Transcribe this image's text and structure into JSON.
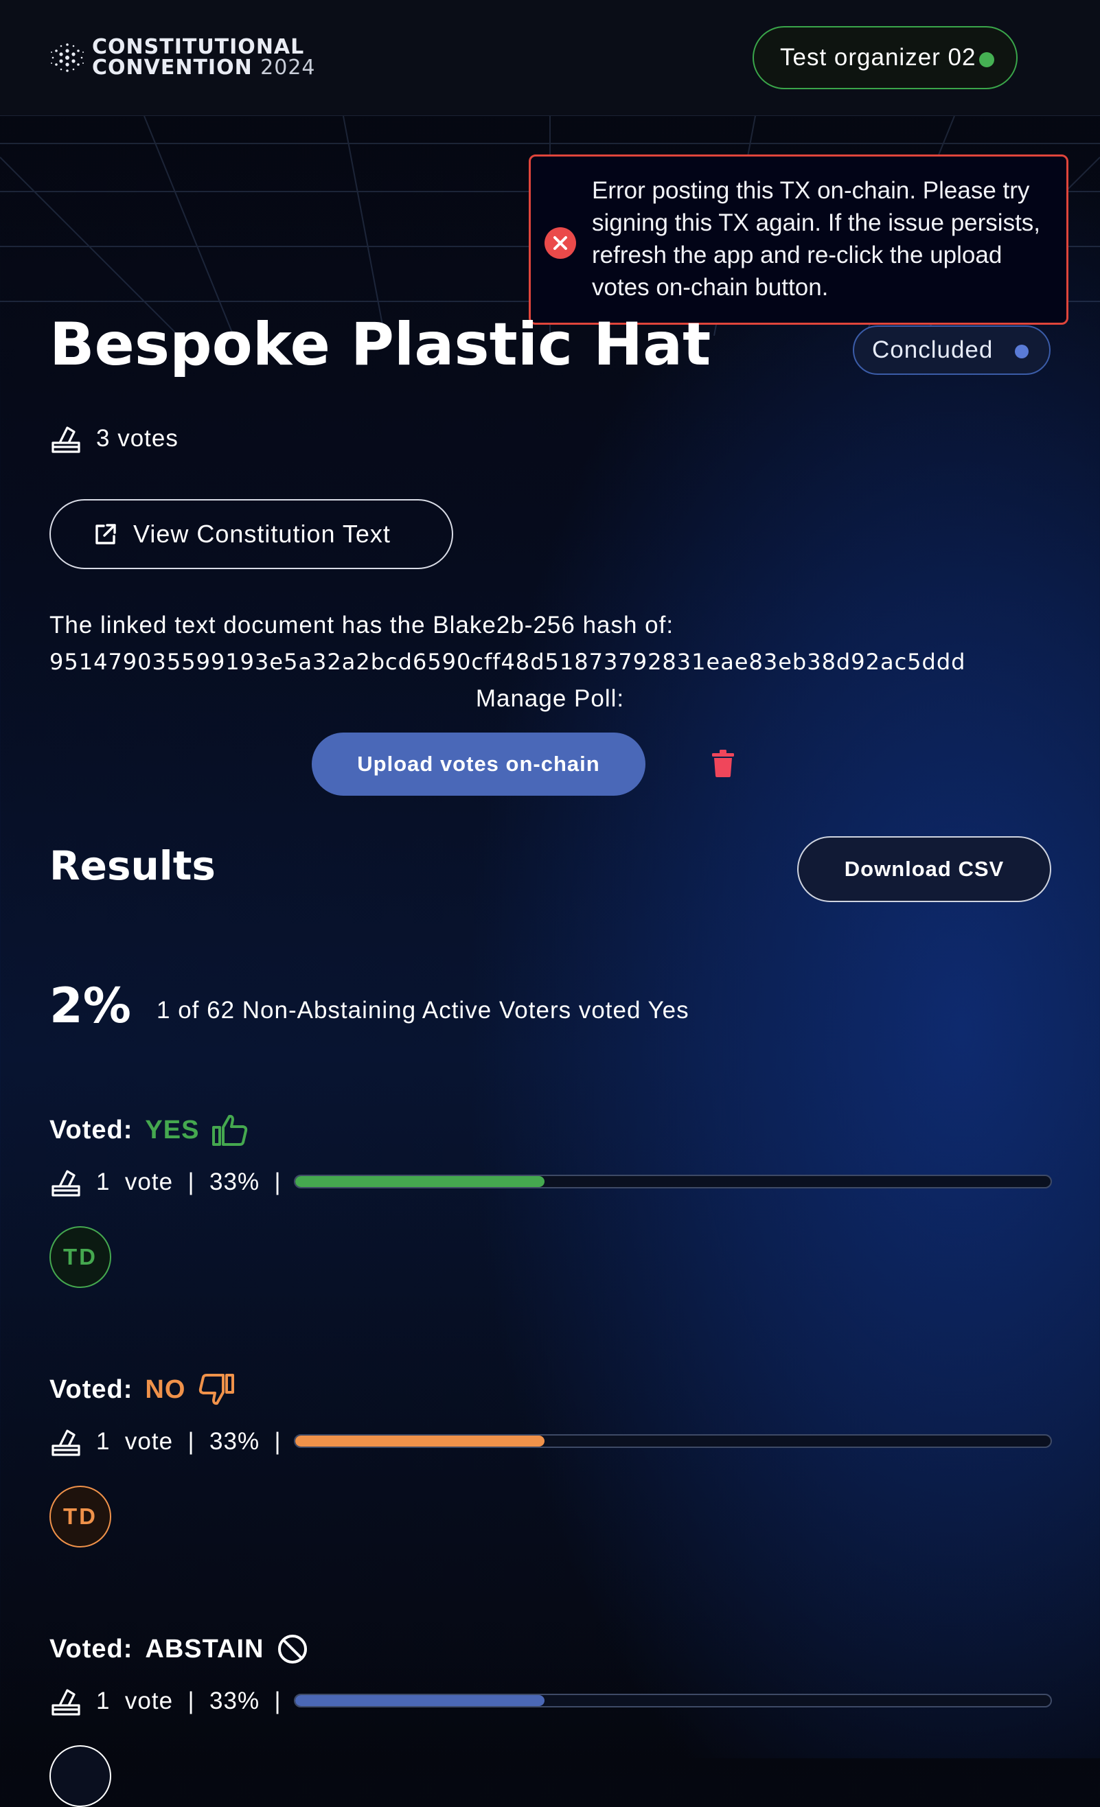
{
  "header": {
    "logo_line1": "CONSTITUTIONAL",
    "logo_line2": "CONVENTION",
    "logo_year": "2024",
    "user_name": "Test organizer 02"
  },
  "toast": {
    "message": "Error posting this TX on-chain. Please try signing this TX again. If the issue persists, refresh the app and re-click the upload votes on-chain button.",
    "icon": "error-x-icon"
  },
  "poll": {
    "title": "Bespoke Plastic Hat",
    "status": "Concluded",
    "votes": "3 votes",
    "view_button": "View Constitution Text",
    "hash_label": "The linked text document has the Blake2b-256 hash of:",
    "hash": "951479035599193e5a32a2bcd6590cff48d51873792831eae83eb38d92ac5ddd",
    "manage_label": "Manage Poll:",
    "upload_button": "Upload votes on-chain"
  },
  "results": {
    "heading": "Results",
    "csv_button": "Download CSV",
    "percent": "2%",
    "summary": "1 of 62 Non-Abstaining Active Voters voted Yes",
    "sections": [
      {
        "label": "Voted:",
        "value": "YES",
        "stat": "1  vote  |  33%  |",
        "fraction": 0.33,
        "avatar": "TD",
        "color": "#45a84f"
      },
      {
        "label": "Voted:",
        "value": "NO",
        "stat": "1  vote  |  33%  |",
        "fraction": 0.33,
        "avatar": "TD",
        "color": "#f0924a"
      },
      {
        "label": "Voted:",
        "value": "ABSTAIN",
        "stat": "1  vote  |  33%  |",
        "fraction": 0.33,
        "color": "#4b68b6"
      }
    ]
  },
  "colors": {
    "accent_blue": "#4a68b8",
    "error_red": "#e0453b",
    "online_green": "#45b053",
    "delete_red": "#f0465b"
  }
}
